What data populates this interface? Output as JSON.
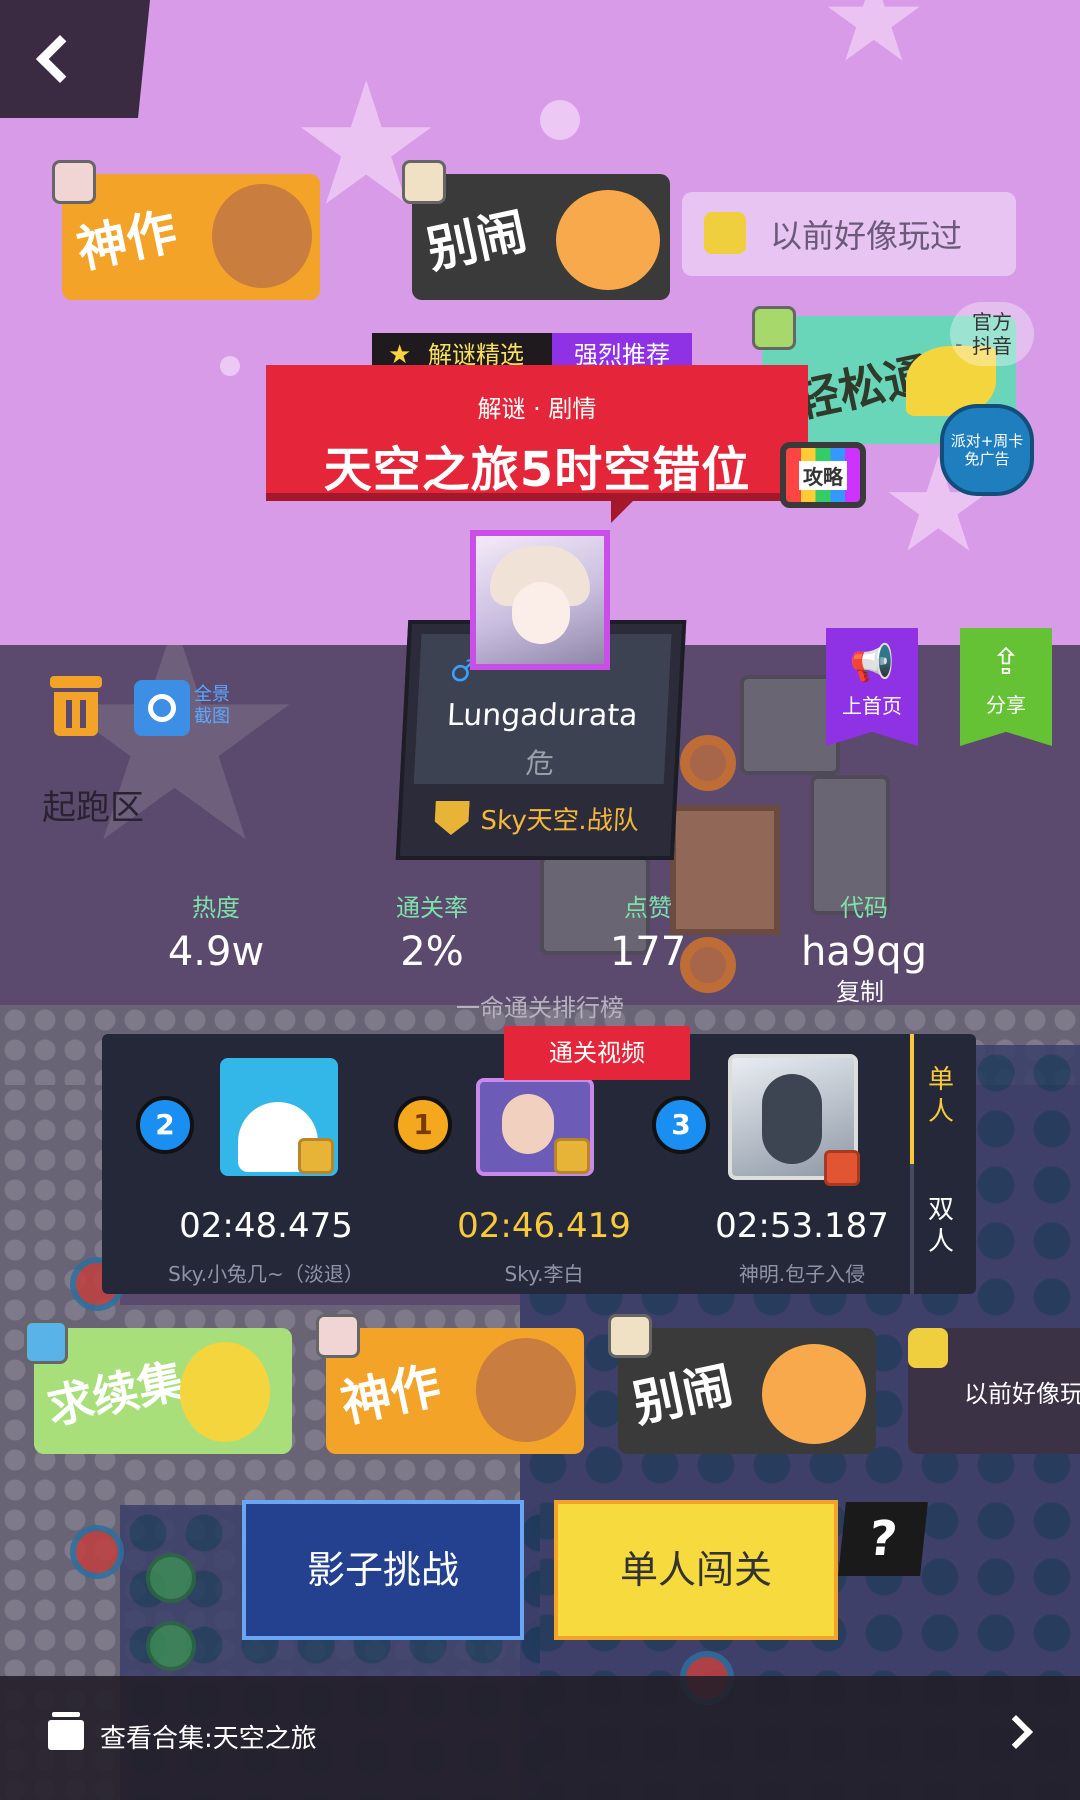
{
  "nav": {
    "back_icon": "chevron-left-icon"
  },
  "reactions_top": [
    {
      "label": "神作",
      "style": "orange"
    },
    {
      "label": "别闹",
      "style": "dark"
    },
    {
      "label": "以前好像玩过",
      "style": "plain"
    }
  ],
  "reactions_side": {
    "label": "轻松通关",
    "badge_top": "官方",
    "badge_bottom": "抖音",
    "promo": "派对+周卡免广告"
  },
  "level": {
    "tag_featured": "解谜精选",
    "tag_recommended": "强烈推荐",
    "genre": "解谜 · 剧情",
    "title": "天空之旅5时空错位",
    "guide_label": "攻略"
  },
  "author": {
    "gender_icon": "male-icon",
    "gender_symbol": "♂",
    "name": "Lungadurata",
    "subtitle": "危",
    "team": "Sky天空.战队"
  },
  "actions": {
    "home_label": "上首页",
    "share_label": "分享",
    "panorama_label": "全景截图",
    "start_zone": "起跑区"
  },
  "stats": [
    {
      "key": "热度",
      "value": "4.9w"
    },
    {
      "key": "通关率",
      "value": "2%"
    },
    {
      "key": "点赞",
      "value": "177"
    },
    {
      "key": "代码",
      "value": "ha9qg"
    }
  ],
  "copy_label": "复制",
  "leaderboard": {
    "title": "一命通关排行榜",
    "video_tag": "通关视频",
    "mode_single": "单人",
    "mode_double": "双人",
    "entries": [
      {
        "rank": "2",
        "time": "02:48.475",
        "name": "Sky.小兔几~（淡退）"
      },
      {
        "rank": "1",
        "time": "02:46.419",
        "name": "Sky.李白"
      },
      {
        "rank": "3",
        "time": "02:53.187",
        "name": "神明.包子入侵"
      }
    ]
  },
  "reactions_bottom": [
    {
      "label": "求续集",
      "style": "green"
    },
    {
      "label": "神作",
      "style": "orange"
    },
    {
      "label": "别闹",
      "style": "dark"
    },
    {
      "label": "以前好像玩",
      "style": "plain-dark"
    }
  ],
  "buttons": {
    "shadow_challenge": "影子挑战",
    "solo_play": "单人闯关",
    "help": "?"
  },
  "footer": {
    "collection": "查看合集:天空之旅"
  }
}
